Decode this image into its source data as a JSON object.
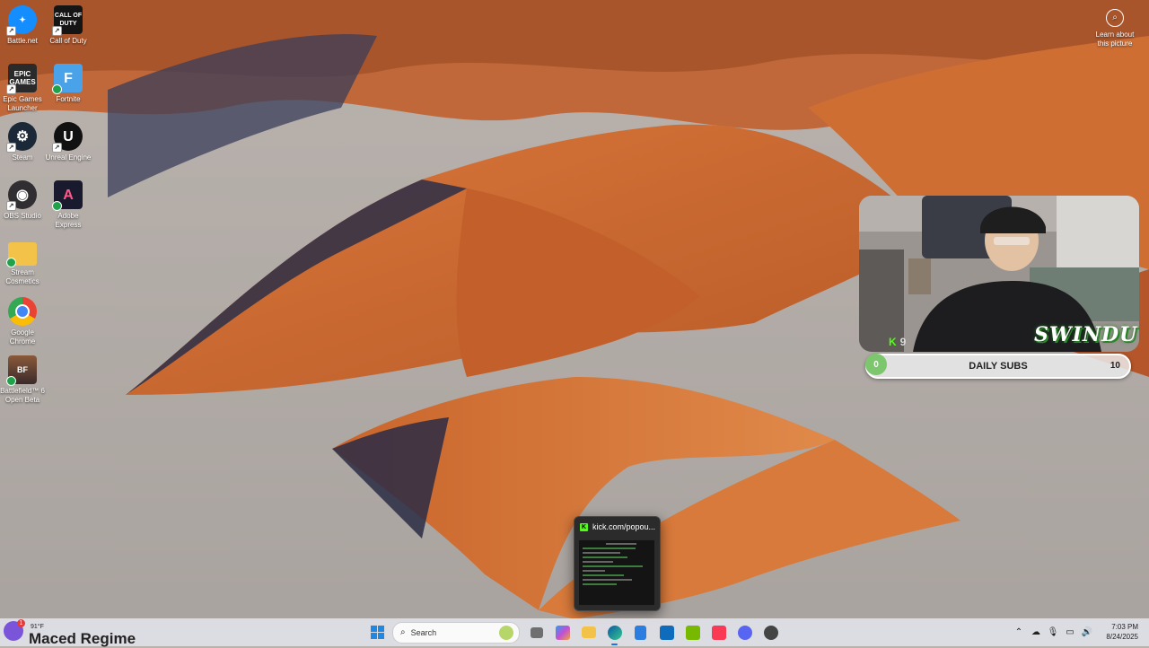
{
  "desktop": {
    "icons": [
      {
        "label": "Battle.net",
        "icon": "battlenet-icon",
        "color": "#148eff",
        "glyph": "✦"
      },
      {
        "label": "Call of Duty",
        "icon": "call-of-duty-icon",
        "color": "#151515",
        "glyph": "CALL OF DUTY"
      },
      {
        "label": "Epic Games Launcher",
        "icon": "epic-games-icon",
        "color": "#2a2a2a",
        "glyph": "EPIC GAMES"
      },
      {
        "label": "Fortnite",
        "icon": "fortnite-icon",
        "color": "#4aa3e8",
        "glyph": "F"
      },
      {
        "label": "Steam",
        "icon": "steam-icon",
        "color": "#1b2838",
        "glyph": "⚙"
      },
      {
        "label": "Unreal Engine",
        "icon": "unreal-engine-icon",
        "color": "#111111",
        "glyph": "U"
      },
      {
        "label": "OBS Studio",
        "icon": "obs-studio-icon",
        "color": "#302e31",
        "glyph": "◉"
      },
      {
        "label": "Adobe Express",
        "icon": "adobe-express-icon",
        "color": "#1a1a2e",
        "glyph": "A"
      },
      {
        "label": "Stream Cosmetics",
        "icon": "folder-icon",
        "color": "#f3c349",
        "glyph": ""
      },
      {
        "label": "Google Chrome",
        "icon": "chrome-icon",
        "color": "#ffffff",
        "glyph": "◎"
      },
      {
        "label": "Battlefield™ 6 Open Beta",
        "icon": "battlefield-icon",
        "color": "#6a4a3a",
        "glyph": "BF"
      }
    ]
  },
  "spotlight": {
    "label": "Learn about this picture",
    "icon": "camera-icon"
  },
  "overlay": {
    "kick_count": "9",
    "kick_letter": "K",
    "brand": "SWINDU",
    "subs_title": "DAILY SUBS",
    "subs_current": "0",
    "subs_goal": "10",
    "subs_progress": 0
  },
  "preview": {
    "title": "kick.com/popou...",
    "app_letter": "K"
  },
  "taskbar": {
    "weather_temp": "91°F",
    "weather_badge": "1",
    "overlay_name": "Maced Regime",
    "search_placeholder": "Search",
    "date": "8/24/2025",
    "time": "7:03 PM",
    "apps": [
      {
        "name": "start-button",
        "color": "#1e88e5"
      },
      {
        "name": "task-view-button",
        "color": "#6f6f6f"
      },
      {
        "name": "copilot-button",
        "color": "#9b59d0"
      },
      {
        "name": "file-explorer-button",
        "color": "#f3c349"
      },
      {
        "name": "edge-button",
        "color": "#1aa0a8"
      },
      {
        "name": "store-button",
        "color": "#2b7de0"
      },
      {
        "name": "outlook-button",
        "color": "#0f6cbd"
      },
      {
        "name": "nvidia-button",
        "color": "#76b900"
      },
      {
        "name": "music-button",
        "color": "#fa3a55"
      },
      {
        "name": "discord-button",
        "color": "#5865f2"
      },
      {
        "name": "obs-button",
        "color": "#444444"
      }
    ]
  }
}
